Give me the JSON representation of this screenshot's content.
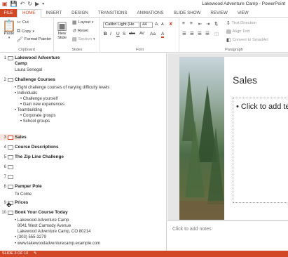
{
  "window": {
    "title": "Lakewood Adventure Camp - PowerPoint",
    "qat_icons": [
      "powerpoint-logo-icon",
      "save-icon",
      "undo-icon",
      "redo-icon",
      "start-from-beginning-icon",
      "customize-qat-icon"
    ]
  },
  "ribbon_tabs": [
    "FILE",
    "HOME",
    "INSERT",
    "DESIGN",
    "TRANSITIONS",
    "ANIMATIONS",
    "SLIDE SHOW",
    "REVIEW",
    "VIEW"
  ],
  "active_tab": "HOME",
  "ribbon": {
    "clipboard": {
      "paste": "Paste",
      "cut": "Cut",
      "copy": "Copy",
      "format_painter": "Format Painter",
      "label": "Clipboard"
    },
    "slides": {
      "new_slide": "New",
      "new_slide_2": "Slide",
      "layout": "Layout",
      "reset": "Reset",
      "section": "Section",
      "label": "Slides"
    },
    "font": {
      "font_name": "Calibri Light (He",
      "font_size": "44",
      "grow": "A",
      "shrink": "A",
      "bold": "B",
      "italic": "I",
      "underline": "U",
      "shadow": "S",
      "strike": "abc",
      "spacing": "AV",
      "case": "Aa",
      "color": "A",
      "label": "Font"
    },
    "paragraph": {
      "text_direction": "Text Direction",
      "align_text": "Align Text",
      "convert_smartart": "Convert to SmartArt",
      "label": "Paragraph"
    }
  },
  "outline": {
    "slides": [
      {
        "num": "1",
        "title_line1": "Lakewood Adventure",
        "title_line2": "Camp",
        "subs": [
          "Laura Senegal"
        ]
      },
      {
        "num": "2",
        "title": "Challenge Courses",
        "subs": [
          "• Eight challenge courses of varying difficulty levels",
          "• Individuals",
          "• Challenge yourself",
          "• Gain new experiences",
          "• Teambuilding",
          "• Corporate groups",
          "• School groups"
        ]
      },
      {
        "num": "3",
        "title": "Sales"
      },
      {
        "num": "4",
        "title": "Course Descriptions"
      },
      {
        "num": "5",
        "title": "The Zip Line Challenge"
      },
      {
        "num": "6",
        "title": ""
      },
      {
        "num": "7",
        "title": ""
      },
      {
        "num": "8",
        "title": "Pamper Pole",
        "subs": [
          "To Come"
        ]
      },
      {
        "num": "9",
        "title": "Prices"
      },
      {
        "num": "10",
        "title": "Book Your Course Today",
        "subs": [
          "• Lakewood Adventure Camp",
          "8041 West Carmody Avenue",
          "Lakewood Adventure Camp, CO 80214",
          "• (303) 555-3279",
          "• www.lakewoodadventurecamp.example.com"
        ]
      }
    ],
    "selected_slide": "3"
  },
  "slide": {
    "title_placeholder": "Sales",
    "content_placeholder": "• Click to add te"
  },
  "notes": {
    "placeholder": "Click to add notes"
  },
  "status": {
    "text": "SLIDE 3 OF 10"
  },
  "colors": {
    "accent": "#d24726",
    "selection": "#fde7df"
  }
}
